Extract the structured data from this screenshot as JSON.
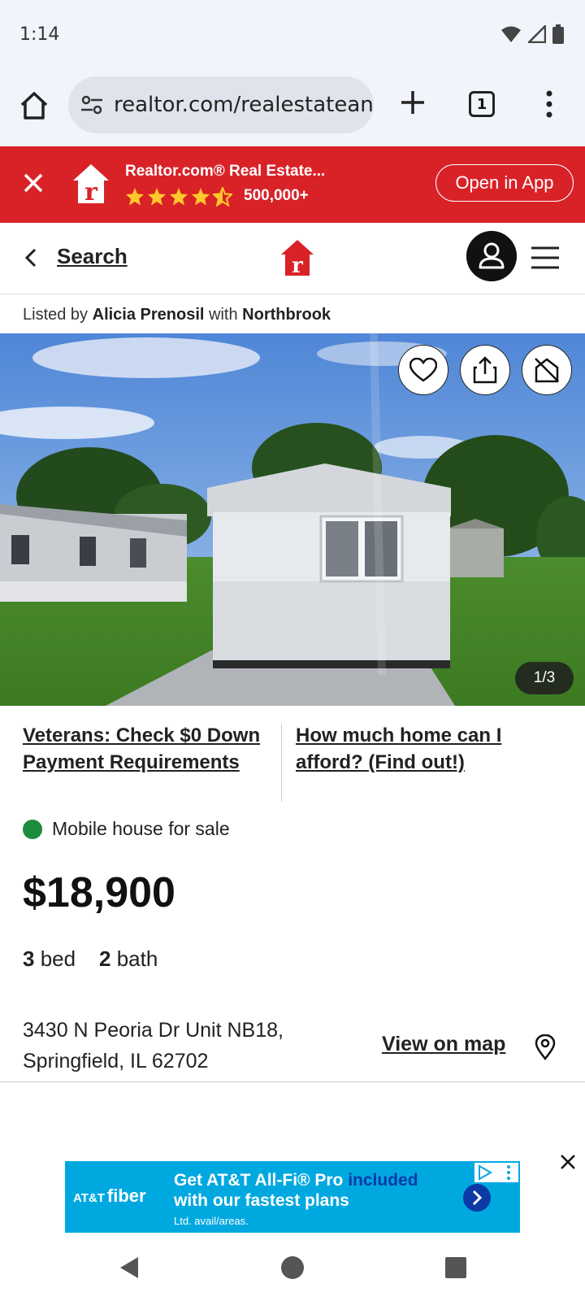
{
  "status_bar": {
    "time": "1:14"
  },
  "browser": {
    "url": "realtor.com/realestatean",
    "tab_count": "1"
  },
  "app_banner": {
    "title": "Realtor.com® Real Estate...",
    "rating_count": "500,000+",
    "open_label": "Open in App",
    "stars": 4.5
  },
  "header": {
    "back_label": "Search"
  },
  "listing": {
    "listed_by_prefix": "Listed by",
    "agent": "Alicia Prenosil",
    "with_word": "with",
    "brokerage": "Northbrook",
    "photo_counter": "1/3",
    "promo_left": "Veterans: Check $0 Down Payment Requirements",
    "promo_right": "How much home can I afford? (Find out!)",
    "status": "Mobile house for sale",
    "price": "$18,900",
    "beds": "3",
    "beds_label": "bed",
    "baths": "2",
    "baths_label": "bath",
    "address_line1": "3430 N Peoria Dr Unit NB18,",
    "address_line2": "Springfield, IL 62702",
    "view_map": "View on map"
  },
  "ad": {
    "brand": "AT&T",
    "brand_product": "fiber",
    "line1": "Get AT&T All-Fi® Pro",
    "line1_highlight": " included",
    "line2": "with our fastest plans",
    "line3": "Ltd. avail/areas."
  },
  "colors": {
    "brand_red": "#d92228",
    "status_green": "#1d8c3d",
    "ad_blue": "#00a8e0",
    "star_yellow": "#ffc92b"
  }
}
